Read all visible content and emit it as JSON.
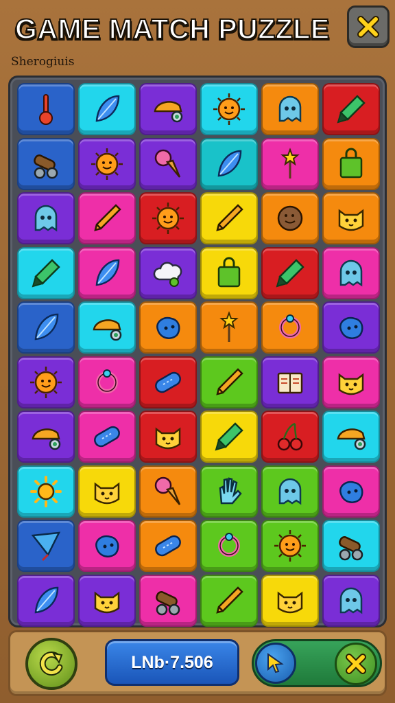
{
  "header": {
    "title": "GAME MATCH PUZZLE",
    "subtitle": "Sherogiuis",
    "close_icon": "close-x-icon"
  },
  "colors": {
    "blue": "#2a63c9",
    "cyan": "#22d6ec",
    "purple": "#7a2ed6",
    "orange": "#f58a0e",
    "red": "#d81e22",
    "pink": "#ee2fa8",
    "yellow": "#f7d90a",
    "green": "#5dc81e",
    "teal": "#19c2c9"
  },
  "board": {
    "rows": [
      [
        {
          "color": "blue",
          "icon": "thermometer"
        },
        {
          "color": "cyan",
          "icon": "leaf"
        },
        {
          "color": "purple",
          "icon": "hat"
        },
        {
          "color": "cyan",
          "icon": "sun-face"
        },
        {
          "color": "orange",
          "icon": "ghost"
        },
        {
          "color": "red",
          "icon": "marker"
        }
      ],
      [
        {
          "color": "blue",
          "icon": "cannon"
        },
        {
          "color": "purple",
          "icon": "sun-face"
        },
        {
          "color": "purple",
          "icon": "ice-cream"
        },
        {
          "color": "teal",
          "icon": "leaf"
        },
        {
          "color": "pink",
          "icon": "wand"
        },
        {
          "color": "orange",
          "icon": "bag"
        }
      ],
      [
        {
          "color": "purple",
          "icon": "ghost"
        },
        {
          "color": "pink",
          "icon": "pencil"
        },
        {
          "color": "red",
          "icon": "sun-face"
        },
        {
          "color": "yellow",
          "icon": "pencil"
        },
        {
          "color": "orange",
          "icon": "cookie"
        },
        {
          "color": "orange",
          "icon": "cat-face"
        }
      ],
      [
        {
          "color": "cyan",
          "icon": "marker"
        },
        {
          "color": "pink",
          "icon": "leaf"
        },
        {
          "color": "purple",
          "icon": "cloud"
        },
        {
          "color": "yellow",
          "icon": "bag"
        },
        {
          "color": "red",
          "icon": "marker"
        },
        {
          "color": "pink",
          "icon": "ghost"
        }
      ],
      [
        {
          "color": "blue",
          "icon": "leaf"
        },
        {
          "color": "cyan",
          "icon": "hat"
        },
        {
          "color": "orange",
          "icon": "blob"
        },
        {
          "color": "orange",
          "icon": "wand"
        },
        {
          "color": "orange",
          "icon": "ring"
        },
        {
          "color": "purple",
          "icon": "blob"
        }
      ],
      [
        {
          "color": "purple",
          "icon": "sun-face"
        },
        {
          "color": "pink",
          "icon": "ring"
        },
        {
          "color": "red",
          "icon": "capsule"
        },
        {
          "color": "green",
          "icon": "pencil"
        },
        {
          "color": "purple",
          "icon": "book"
        },
        {
          "color": "pink",
          "icon": "cat-face"
        }
      ],
      [
        {
          "color": "purple",
          "icon": "hat"
        },
        {
          "color": "pink",
          "icon": "capsule"
        },
        {
          "color": "red",
          "icon": "cat-face"
        },
        {
          "color": "yellow",
          "icon": "marker"
        },
        {
          "color": "red",
          "icon": "cherry"
        },
        {
          "color": "cyan",
          "icon": "hat"
        }
      ],
      [
        {
          "color": "cyan",
          "icon": "sun"
        },
        {
          "color": "yellow",
          "icon": "cat-face"
        },
        {
          "color": "orange",
          "icon": "ice-cream"
        },
        {
          "color": "green",
          "icon": "hand"
        },
        {
          "color": "green",
          "icon": "ghost"
        },
        {
          "color": "pink",
          "icon": "blob"
        }
      ],
      [
        {
          "color": "blue",
          "icon": "kite"
        },
        {
          "color": "pink",
          "icon": "blob"
        },
        {
          "color": "orange",
          "icon": "capsule"
        },
        {
          "color": "green",
          "icon": "ring"
        },
        {
          "color": "green",
          "icon": "sun-face"
        },
        {
          "color": "cyan",
          "icon": "cannon"
        }
      ],
      [
        {
          "color": "purple",
          "icon": "leaf"
        },
        {
          "color": "purple",
          "icon": "cat-face"
        },
        {
          "color": "pink",
          "icon": "cannon"
        },
        {
          "color": "green",
          "icon": "pencil"
        },
        {
          "color": "yellow",
          "icon": "cat-face"
        },
        {
          "color": "purple",
          "icon": "ghost"
        }
      ]
    ]
  },
  "footer": {
    "refresh_icon": "refresh-icon",
    "score_text": "LNb·7.506",
    "hint_icon": "hint-cursor-icon",
    "cancel_icon": "close-x-icon"
  }
}
